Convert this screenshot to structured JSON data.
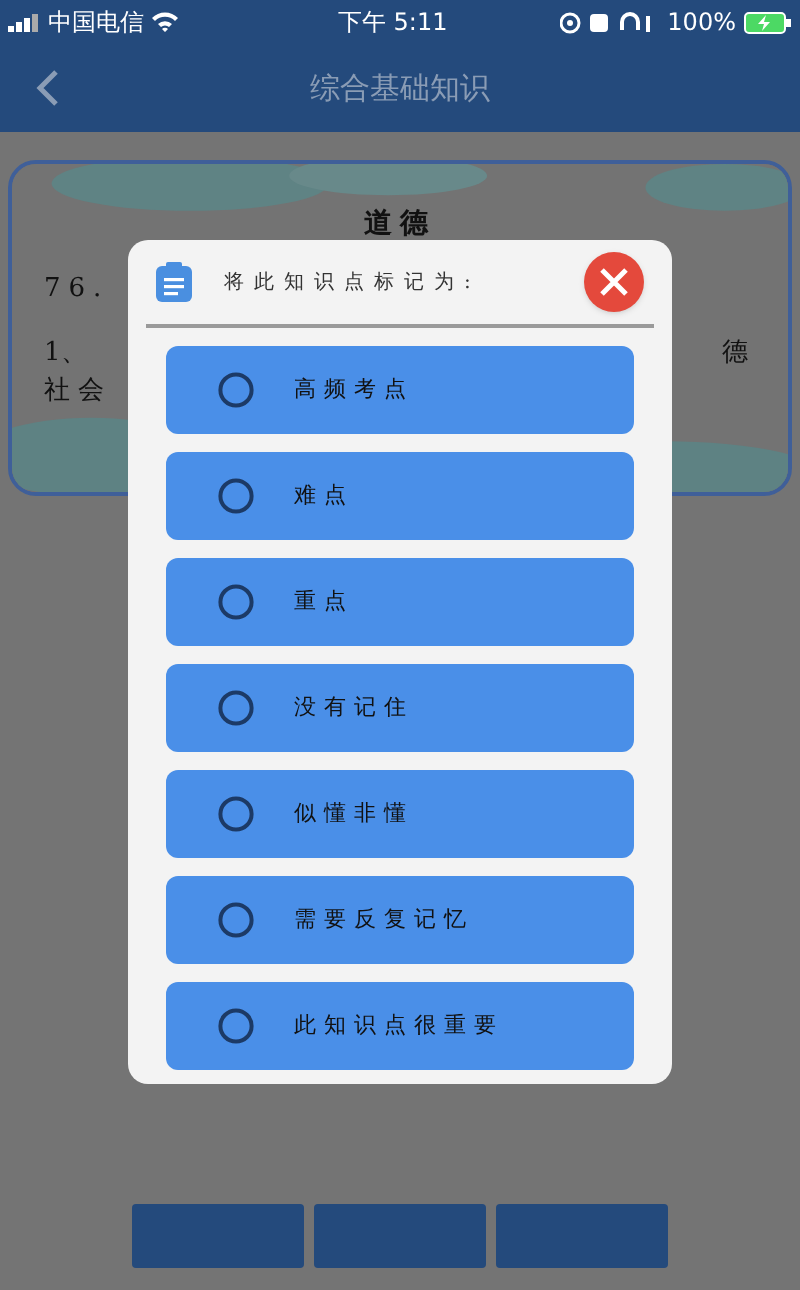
{
  "status_bar": {
    "carrier": "中国电信",
    "time": "下午 5:11",
    "battery": "100%"
  },
  "header": {
    "title": "综合基础知识"
  },
  "card": {
    "title": "道德",
    "lines": [
      "76.",
      "1、",
      "德",
      "社会"
    ]
  },
  "dialog": {
    "title": "将此知识点标记为:",
    "options": [
      {
        "label": "高频考点",
        "selected": false
      },
      {
        "label": "难点",
        "selected": false
      },
      {
        "label": "重点",
        "selected": false
      },
      {
        "label": "没有记住",
        "selected": false
      },
      {
        "label": "似懂非懂",
        "selected": false
      },
      {
        "label": "需要反复记忆",
        "selected": false
      },
      {
        "label": "此知识点很重要",
        "selected": false
      }
    ]
  }
}
